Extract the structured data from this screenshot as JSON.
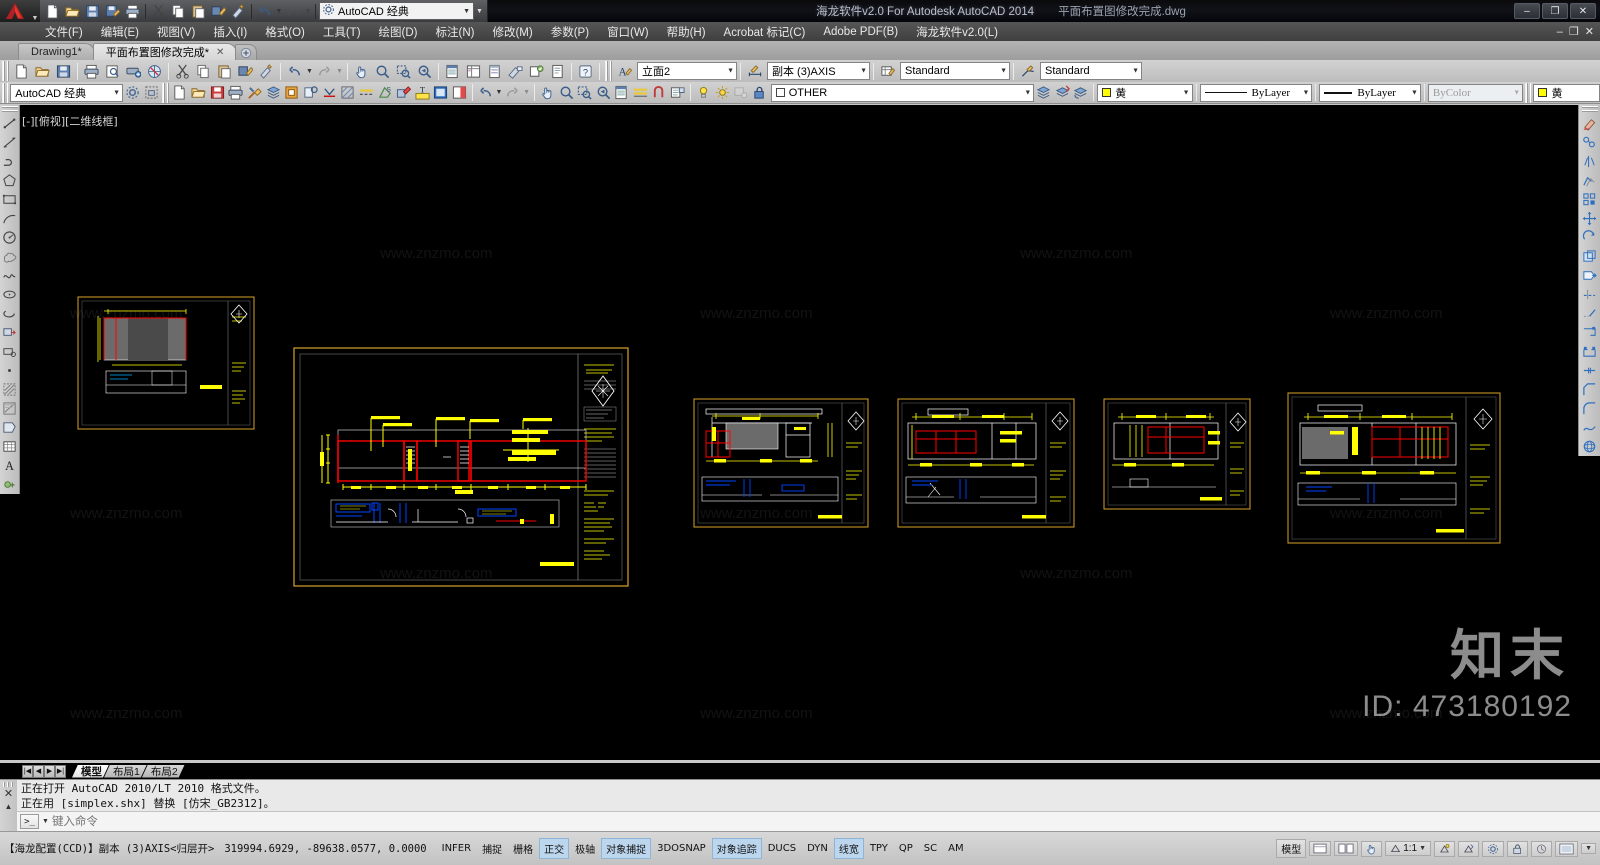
{
  "window": {
    "app_title": "海龙软件v2.0 For Autodesk AutoCAD 2014",
    "document_title": "平面布置图修改完成.dwg",
    "minimize": "–",
    "maximize": "❐",
    "close": "✕",
    "mdi_minimize": "–",
    "mdi_restore": "❐",
    "mdi_close": "✕"
  },
  "quick_access": {
    "workspace_value": "AutoCAD 经典",
    "buttons": [
      {
        "name": "new-icon",
        "label": "新建"
      },
      {
        "name": "open-icon",
        "label": "打开"
      },
      {
        "name": "save-icon",
        "label": "保存"
      },
      {
        "name": "save-as-icon",
        "label": "另存为"
      },
      {
        "name": "plot-icon",
        "label": "打印"
      },
      {
        "name": "undo-icon",
        "label": "放弃"
      },
      {
        "name": "redo-icon",
        "label": "重做"
      }
    ]
  },
  "menu": {
    "items": [
      "文件(F)",
      "编辑(E)",
      "视图(V)",
      "插入(I)",
      "格式(O)",
      "工具(T)",
      "绘图(D)",
      "标注(N)",
      "修改(M)",
      "参数(P)",
      "窗口(W)",
      "帮助(H)",
      "Acrobat 标记(C)",
      "Adobe PDF(B)",
      "海龙软件v2.0(L)"
    ]
  },
  "document_tabs": {
    "tabs": [
      {
        "label": "Drawing1*",
        "active": false,
        "closable": false
      },
      {
        "label": "平面布置图修改完成*",
        "active": true,
        "closable": true
      }
    ],
    "new_tab_label": "+"
  },
  "toolbar_row1": {
    "workspace_combo": "AutoCAD 经典",
    "text_style_combo": "立面2",
    "dim_style_combo": "副本 (3)AXIS",
    "table_style_combo": "Standard",
    "multileader_style_combo": "Standard"
  },
  "toolbar_row2": {
    "layer_combo": "OTHER",
    "color_combo": "黄",
    "linetype_combo": "ByLayer",
    "lineweight_combo": "ByLayer",
    "plotstyle_combo": "ByColor",
    "color_combo_2": "黄"
  },
  "canvas": {
    "viewport_label": "[-][俯视][二维线框]",
    "background": "#000000",
    "drawing_colors": {
      "yellow": "#ffff00",
      "red": "#ff0000",
      "white": "#ffffff",
      "blue": "#0000ff",
      "cyan": "#00ffff",
      "gray": "#808080"
    }
  },
  "layout_tabs": {
    "nav": [
      "|◀",
      "◀",
      "▶",
      "▶|"
    ],
    "tabs": [
      {
        "label": "模型",
        "active": true
      },
      {
        "label": "布局1",
        "active": false
      },
      {
        "label": "布局2",
        "active": false
      }
    ]
  },
  "command_window": {
    "history": [
      "正在打开 AutoCAD 2010/LT 2010 格式文件。",
      "正在用 [simplex.shx] 替换 [仿宋_GB2312]。"
    ],
    "prompt_icon": ">_",
    "placeholder": "键入命令",
    "value": ""
  },
  "status_bar": {
    "profile": "【海龙配置(CCD)】副本 (3)AXIS<归层开>",
    "coordinates": "319994.6929, -89638.0577, 0.0000",
    "toggles": [
      {
        "label": "INFER",
        "on": false
      },
      {
        "label": "捕捉",
        "on": false
      },
      {
        "label": "栅格",
        "on": false
      },
      {
        "label": "正交",
        "on": true
      },
      {
        "label": "极轴",
        "on": false
      },
      {
        "label": "对象捕捉",
        "on": true
      },
      {
        "label": "3DOSNAP",
        "on": false
      },
      {
        "label": "对象追踪",
        "on": true
      },
      {
        "label": "DUCS",
        "on": false
      },
      {
        "label": "DYN",
        "on": false
      },
      {
        "label": "线宽",
        "on": true
      },
      {
        "label": "TPY",
        "on": false
      },
      {
        "label": "QP",
        "on": false
      },
      {
        "label": "SC",
        "on": false
      },
      {
        "label": "AM",
        "on": false
      }
    ],
    "model_button": "模型",
    "annotation_scale": "1:1",
    "right_items": [
      "模型",
      "1:1"
    ]
  },
  "watermarks": {
    "tile_text": "www.znzmo.com",
    "brand": "知末",
    "id": "ID: 473180192"
  }
}
